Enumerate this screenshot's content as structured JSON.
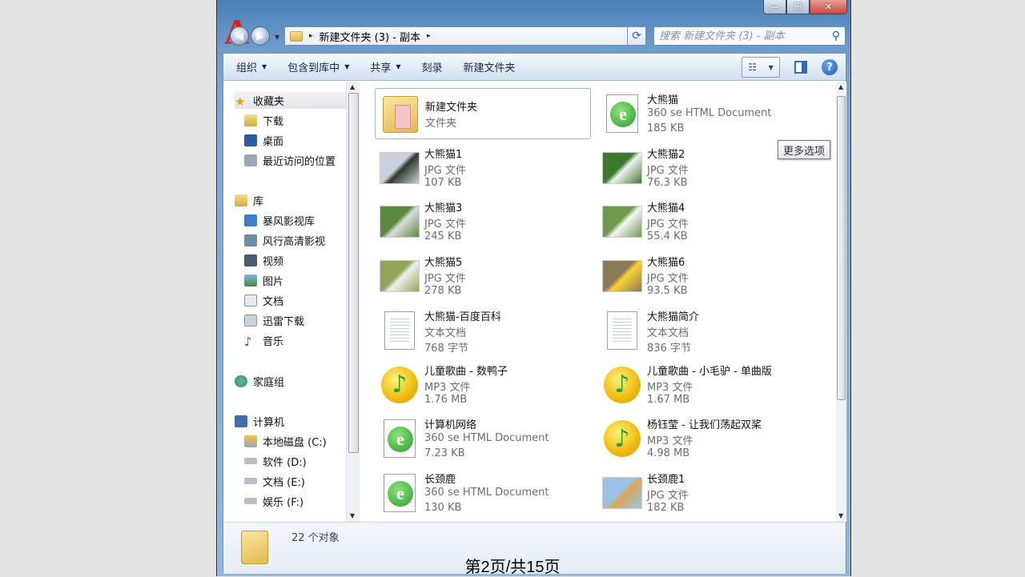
{
  "window": {
    "title_buttons": [
      "—",
      "❐",
      "✕"
    ],
    "logo_letter": "A"
  },
  "address": {
    "path": "新建文件夹 (3) - 副本",
    "sep": "▸"
  },
  "search": {
    "placeholder": "搜索 新建文件夹 (3) - 副本"
  },
  "toolbar": {
    "organize": "组织",
    "include": "包含到库中",
    "share": "共享",
    "burn": "刻录",
    "new_folder": "新建文件夹",
    "tooltip": "更多选项"
  },
  "nav": {
    "favorites": "收藏夹",
    "downloads": "下载",
    "desktop": "桌面",
    "recent": "最近访问的位置",
    "library": "库",
    "baofeng": "暴风影视库",
    "fengxing": "风行高清影视",
    "video": "视频",
    "pictures": "图片",
    "docs": "文档",
    "xunlei": "迅雷下载",
    "music": "音乐",
    "homegroup": "家庭组",
    "computer": "计算机",
    "disk_c": "本地磁盘 (C:)",
    "disk_d": "软件 (D:)",
    "disk_e": "文档 (E:)",
    "disk_f": "娱乐 (F:)"
  },
  "files": [
    {
      "name": "新建文件夹",
      "type": "文件夹",
      "size": "",
      "icon": "folder-icon"
    },
    {
      "name": "大熊猫",
      "type": "360 se HTML Document",
      "size": "185 KB",
      "icon": "html-document-icon"
    },
    {
      "name": "大熊猫1",
      "type": "JPG 文件",
      "size": "107 KB",
      "icon": "image-thumbnail"
    },
    {
      "name": "大熊猫2",
      "type": "JPG 文件",
      "size": "76.3 KB",
      "icon": "image-thumbnail"
    },
    {
      "name": "大熊猫3",
      "type": "JPG 文件",
      "size": "245 KB",
      "icon": "image-thumbnail"
    },
    {
      "name": "大熊猫4",
      "type": "JPG 文件",
      "size": "55.4 KB",
      "icon": "image-thumbnail"
    },
    {
      "name": "大熊猫5",
      "type": "JPG 文件",
      "size": "278 KB",
      "icon": "image-thumbnail"
    },
    {
      "name": "大熊猫6",
      "type": "JPG 文件",
      "size": "93.5 KB",
      "icon": "image-thumbnail"
    },
    {
      "name": "大熊猫-百度百科",
      "type": "文本文档",
      "size": "768 字节",
      "icon": "text-document-icon"
    },
    {
      "name": "大熊猫简介",
      "type": "文本文档",
      "size": "836 字节",
      "icon": "text-document-icon"
    },
    {
      "name": "儿童歌曲 - 数鸭子",
      "type": "MP3 文件",
      "size": "1.76 MB",
      "icon": "mp3-icon"
    },
    {
      "name": "儿童歌曲 - 小毛驴 - 单曲版",
      "type": "MP3 文件",
      "size": "1.67 MB",
      "icon": "mp3-icon"
    },
    {
      "name": "计算机网络",
      "type": "360 se HTML Document",
      "size": "7.23 KB",
      "icon": "html-document-icon"
    },
    {
      "name": "杨钰莹 - 让我们荡起双桨",
      "type": "MP3 文件",
      "size": "4.98 MB",
      "icon": "mp3-icon"
    },
    {
      "name": "长颈鹿",
      "type": "360 se HTML Document",
      "size": "130 KB",
      "icon": "html-document-icon"
    },
    {
      "name": "长颈鹿1",
      "type": "JPG 文件",
      "size": "182 KB",
      "icon": "image-thumbnail"
    }
  ],
  "status": {
    "count": "22 个对象"
  },
  "footer": {
    "page": "第2页/共15页"
  }
}
